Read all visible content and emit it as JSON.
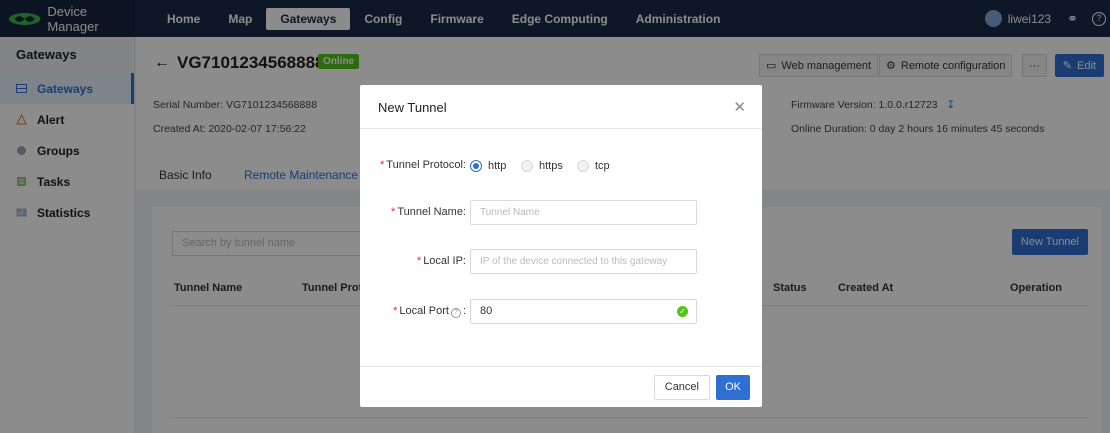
{
  "app": {
    "title": "Device Manager"
  },
  "nav": {
    "items": [
      {
        "label": "Home"
      },
      {
        "label": "Map"
      },
      {
        "label": "Gateways"
      },
      {
        "label": "Config"
      },
      {
        "label": "Firmware"
      },
      {
        "label": "Edge Computing"
      },
      {
        "label": "Administration"
      }
    ],
    "active": "Gateways",
    "username": "liwei123"
  },
  "sidebar": {
    "title": "Gateways",
    "items": [
      {
        "label": "Gateways",
        "icon": "gateway-icon"
      },
      {
        "label": "Alert",
        "icon": "alert-icon"
      },
      {
        "label": "Groups",
        "icon": "groups-icon"
      },
      {
        "label": "Tasks",
        "icon": "tasks-icon"
      },
      {
        "label": "Statistics",
        "icon": "statistics-icon"
      }
    ]
  },
  "gateway": {
    "name": "VG7101234568888",
    "status": "Online",
    "serial_label": "Serial Number:",
    "serial": "VG7101234568888",
    "created_label": "Created At:",
    "created": "2020-02-07 17:56:22",
    "firmware_label": "Firmware Version:",
    "firmware": "1.0.0.r12723",
    "online_label": "Online Duration:",
    "online": "0 day 2 hours 16 minutes 45 seconds"
  },
  "actions": {
    "web_management": "Web management",
    "remote_configuration": "Remote configuration",
    "more": "···",
    "edit": "Edit"
  },
  "tabs": [
    {
      "label": "Basic Info"
    },
    {
      "label": "Remote Maintenance"
    }
  ],
  "tunnels": {
    "search_placeholder": "Search by tunnel name",
    "new_tunnel": "New Tunnel",
    "columns": [
      "Tunnel Name",
      "Tunnel Proto",
      "Status",
      "Created At",
      "Operation"
    ]
  },
  "modal": {
    "title": "New Tunnel",
    "protocol_label": "Tunnel Protocol:",
    "protocols": [
      "http",
      "https",
      "tcp"
    ],
    "protocol_selected": "http",
    "name_label": "Tunnel Name:",
    "name_placeholder": "Tunnel Name",
    "ip_label": "Local IP:",
    "ip_placeholder": "IP of the device connected to this gateway",
    "port_label": "Local Port",
    "port_value": "80",
    "cancel": "Cancel",
    "ok": "OK"
  },
  "colors": {
    "primary": "#2f6fd1",
    "nav_bg": "#1b2a4a",
    "online": "#52c41a"
  }
}
